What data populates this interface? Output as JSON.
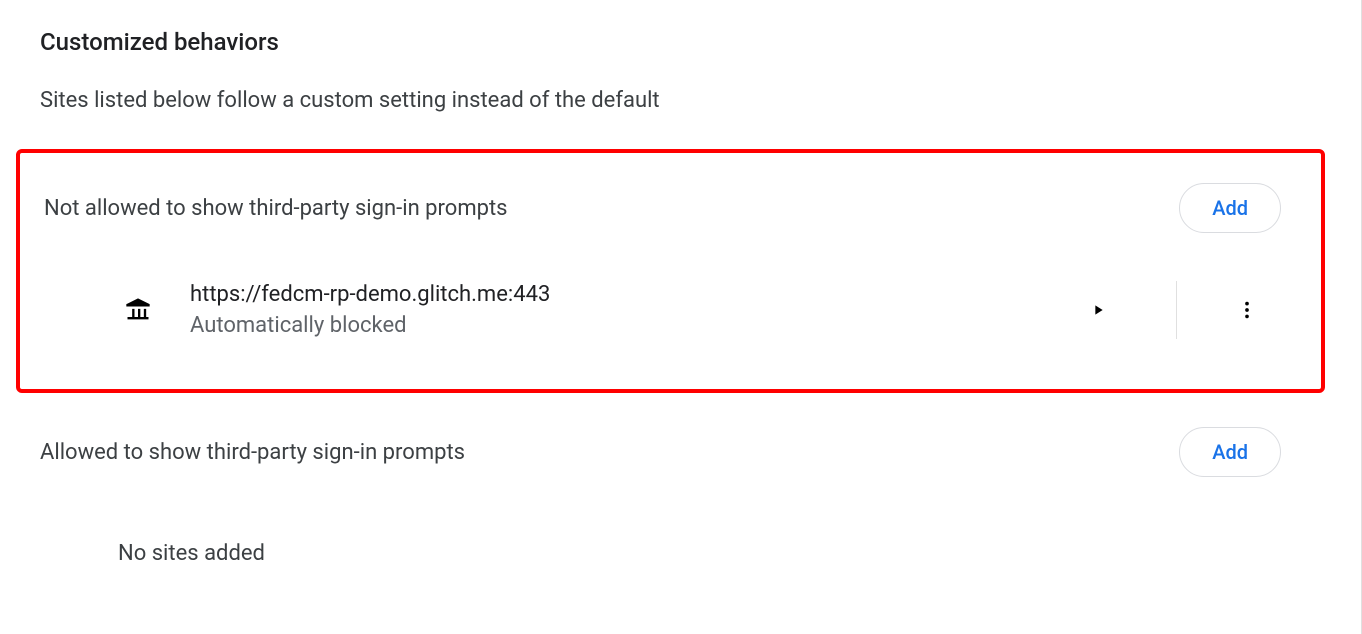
{
  "heading": "Customized behaviors",
  "description": "Sites listed below follow a custom setting instead of the default",
  "not_allowed": {
    "title": "Not allowed to show third-party sign-in prompts",
    "add_label": "Add",
    "sites": [
      {
        "url": "https://fedcm-rp-demo.glitch.me:443",
        "status": "Automatically blocked"
      }
    ]
  },
  "allowed": {
    "title": "Allowed to show third-party sign-in prompts",
    "add_label": "Add",
    "empty_message": "No sites added"
  }
}
